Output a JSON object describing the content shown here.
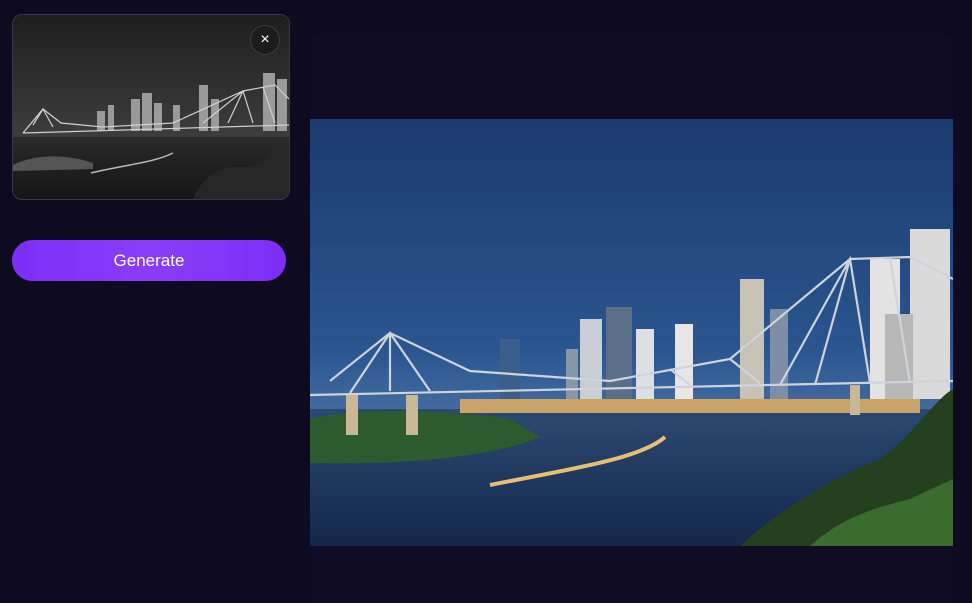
{
  "upload": {
    "thumbnail_icon": "uploaded-image-grayscale",
    "close_label": "×"
  },
  "actions": {
    "generate_label": "Generate"
  },
  "result": {
    "image_icon": "colorized-output-image"
  },
  "colors": {
    "background": "#0e0a20",
    "accent": "#7b2ff7",
    "panel": "#100c24"
  }
}
